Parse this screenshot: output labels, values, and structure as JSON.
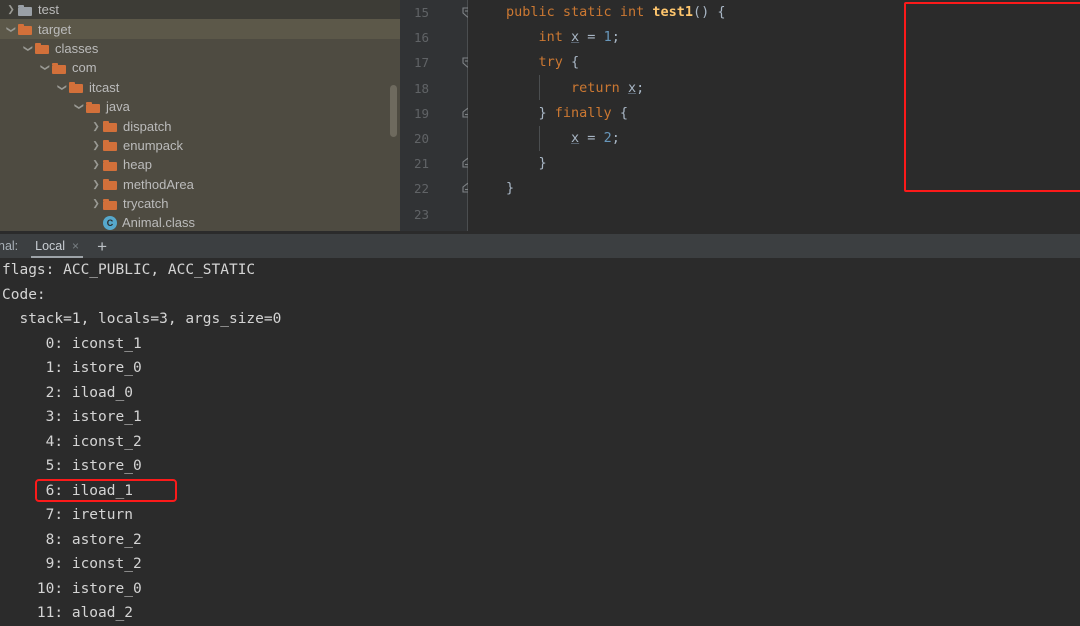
{
  "project_tree": {
    "rows": [
      {
        "indent": 0,
        "arrow": "collapsed",
        "icon": "folder-grey",
        "label": "test",
        "state": "dim"
      },
      {
        "indent": 0,
        "arrow": "expanded",
        "icon": "folder",
        "label": "target",
        "state": "selected"
      },
      {
        "indent": 1,
        "arrow": "expanded",
        "icon": "folder",
        "label": "classes",
        "state": "normal"
      },
      {
        "indent": 2,
        "arrow": "expanded",
        "icon": "folder",
        "label": "com",
        "state": "normal"
      },
      {
        "indent": 3,
        "arrow": "expanded",
        "icon": "folder",
        "label": "itcast",
        "state": "normal"
      },
      {
        "indent": 4,
        "arrow": "expanded",
        "icon": "folder",
        "label": "java",
        "state": "normal"
      },
      {
        "indent": 5,
        "arrow": "collapsed",
        "icon": "folder",
        "label": "dispatch",
        "state": "normal"
      },
      {
        "indent": 5,
        "arrow": "collapsed",
        "icon": "folder",
        "label": "enumpack",
        "state": "normal"
      },
      {
        "indent": 5,
        "arrow": "collapsed",
        "icon": "folder",
        "label": "heap",
        "state": "normal"
      },
      {
        "indent": 5,
        "arrow": "collapsed",
        "icon": "folder",
        "label": "methodArea",
        "state": "normal"
      },
      {
        "indent": 5,
        "arrow": "collapsed",
        "icon": "folder",
        "label": "trycatch",
        "state": "normal"
      },
      {
        "indent": 5,
        "arrow": "none",
        "icon": "class",
        "label": "Animal.class",
        "state": "normal"
      }
    ],
    "class_icon_letter": "C"
  },
  "editor": {
    "line_numbers": [
      "15",
      "16",
      "17",
      "18",
      "19",
      "20",
      "21",
      "22",
      "23"
    ],
    "fold_markers": [
      {
        "line": 0,
        "type": "collapse"
      },
      {
        "line": 2,
        "type": "collapse"
      },
      {
        "line": 4,
        "type": "end"
      },
      {
        "line": 6,
        "type": "end"
      },
      {
        "line": 7,
        "type": "end"
      }
    ],
    "lines": [
      [
        {
          "t": "public ",
          "c": "kw"
        },
        {
          "t": "static ",
          "c": "kw"
        },
        {
          "t": "int ",
          "c": "kw"
        },
        {
          "t": "test1",
          "c": "mth"
        },
        {
          "t": "() {",
          "c": "pl"
        }
      ],
      [
        {
          "t": "    ",
          "c": "pl"
        },
        {
          "t": "int ",
          "c": "kw"
        },
        {
          "t": "x",
          "c": "var"
        },
        {
          "t": " = ",
          "c": "pl"
        },
        {
          "t": "1",
          "c": "num"
        },
        {
          "t": ";",
          "c": "pl"
        }
      ],
      [
        {
          "t": "    ",
          "c": "pl"
        },
        {
          "t": "try",
          "c": "kw"
        },
        {
          "t": " {",
          "c": "pl"
        }
      ],
      [
        {
          "t": "        ",
          "c": "pl"
        },
        {
          "t": "return ",
          "c": "kw"
        },
        {
          "t": "x",
          "c": "var"
        },
        {
          "t": ";",
          "c": "pl"
        }
      ],
      [
        {
          "t": "    } ",
          "c": "pl"
        },
        {
          "t": "finally",
          "c": "kw"
        },
        {
          "t": " {",
          "c": "pl"
        }
      ],
      [
        {
          "t": "        ",
          "c": "pl"
        },
        {
          "t": "x",
          "c": "var"
        },
        {
          "t": " = ",
          "c": "pl"
        },
        {
          "t": "2",
          "c": "num"
        },
        {
          "t": ";",
          "c": "pl"
        }
      ],
      [
        {
          "t": "    }",
          "c": "pl"
        }
      ],
      [
        {
          "t": "}",
          "c": "pl"
        }
      ],
      [
        {
          "t": "",
          "c": "pl"
        }
      ]
    ],
    "highlight_color": "#fc1a1a"
  },
  "terminal": {
    "title": "nal:",
    "tab_label": "Local",
    "tab_close_icon": "×",
    "add_icon": "+",
    "output": [
      "flags: ACC_PUBLIC, ACC_STATIC",
      "Code:",
      "  stack=1, locals=3, args_size=0",
      "     0: iconst_1",
      "     1: istore_0",
      "     2: iload_0",
      "     3: istore_1",
      "     4: iconst_2",
      "     5: istore_0",
      "     6: iload_1",
      "     7: ireturn",
      "     8: astore_2",
      "     9: iconst_2",
      "    10: istore_0",
      "    11: aload_2"
    ],
    "highlighted_line_index": 9,
    "highlight_color": "#fc1a1a"
  }
}
